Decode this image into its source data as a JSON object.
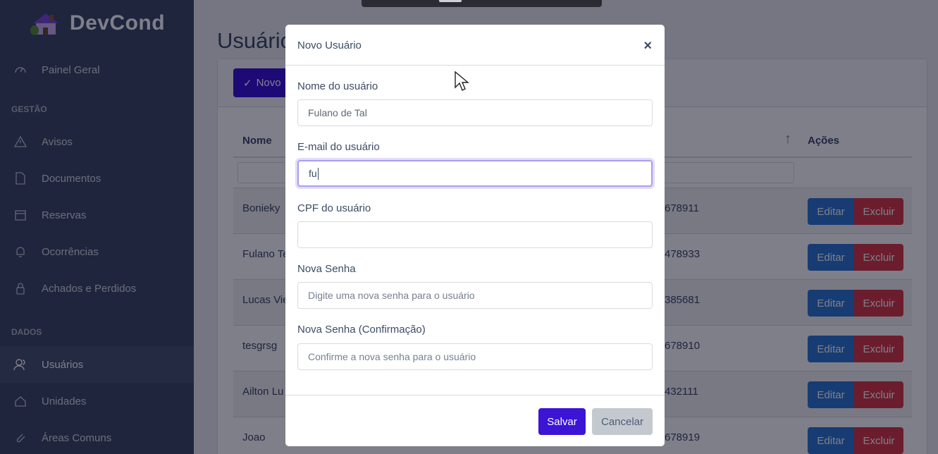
{
  "sidebar": {
    "brand": "DevCond",
    "items": [
      {
        "label": "Painel Geral",
        "icon": "speedometer-icon"
      },
      {
        "section": "GESTÃO"
      },
      {
        "label": "Avisos",
        "icon": "warning-icon"
      },
      {
        "label": "Documentos",
        "icon": "document-icon"
      },
      {
        "label": "Reservas",
        "icon": "calendar-icon"
      },
      {
        "label": "Ocorrências",
        "icon": "bell-icon"
      },
      {
        "label": "Achados e Perdidos",
        "icon": "lock-icon"
      },
      {
        "section": "DADOS"
      },
      {
        "label": "Usuários",
        "icon": "people-icon",
        "active": true
      },
      {
        "label": "Unidades",
        "icon": "home-icon"
      },
      {
        "label": "Áreas Comuns",
        "icon": "paperclip-icon"
      }
    ],
    "painel": "Painel Geral",
    "gestao": "GESTÃO",
    "avisos": "Avisos",
    "documentos": "Documentos",
    "reservas": "Reservas",
    "ocorrencias": "Ocorrências",
    "achados": "Achados e Perdidos",
    "dados": "DADOS",
    "usuarios": "Usuários",
    "unidades": "Unidades",
    "areas": "Áreas Comuns"
  },
  "main": {
    "title": "Usuários",
    "new_button": "Novo",
    "table": {
      "headers": {
        "nome": "Nome",
        "acoes": "Ações"
      },
      "rows": [
        {
          "name": "Bonieky",
          "cpf": "678911"
        },
        {
          "name": "Fulano Te",
          "cpf": "478933"
        },
        {
          "name": "Lucas Vie",
          "cpf": "385681"
        },
        {
          "name": "tesgrsg",
          "cpf": "678910"
        },
        {
          "name": "Ailton Lu",
          "cpf": "432111"
        },
        {
          "name": "Joao",
          "cpf": "678919"
        }
      ],
      "edit_label": "Editar",
      "delete_label": "Excluir"
    }
  },
  "modal": {
    "title": "Novo Usuário",
    "close": "×",
    "name_label": "Nome do usuário",
    "name_value": "Fulano de Tal",
    "email_label": "E-mail do usuário",
    "email_value": "fu",
    "cpf_label": "CPF do usuário",
    "cpf_value": "",
    "password_label": "Nova Senha",
    "password_placeholder": "Digite uma nova senha para o usuário",
    "confirm_label": "Nova Senha (Confirmação)",
    "confirm_placeholder": "Confirme a nova senha para o usuário",
    "save": "Salvar",
    "cancel": "Cancelar"
  },
  "colors": {
    "sidebar": "#3c4b64",
    "primary": "#3b14d6",
    "edit": "#2f79d1",
    "delete": "#d93a45"
  }
}
